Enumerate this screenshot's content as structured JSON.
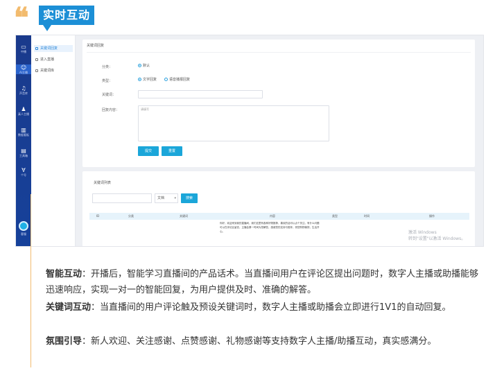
{
  "header": {
    "quote_mark": "❝",
    "title": "实时互动"
  },
  "app": {
    "sidebar": [
      {
        "label": "中播",
        "icon": "broadcast-icon",
        "glyph": "▭"
      },
      {
        "label": "AI主播",
        "icon": "robot-icon",
        "glyph": "☺"
      },
      {
        "label": "声音库",
        "icon": "voice-icon",
        "glyph": "♫"
      },
      {
        "label": "真人主播",
        "icon": "person-icon",
        "glyph": "♟"
      },
      {
        "label": "数据看板",
        "icon": "chart-icon",
        "glyph": "▥"
      },
      {
        "label": "工具箱",
        "icon": "toolbox-icon",
        "glyph": "▤"
      },
      {
        "label": "个号",
        "icon": "account-icon",
        "glyph": "∀"
      }
    ],
    "sidebar_bottom_label": "客服",
    "submenu": [
      "关键词回复",
      "进入直播",
      "关键词库"
    ],
    "form": {
      "title": "关键词回复",
      "labels": {
        "category": "分类：",
        "type": "类型：",
        "keyword": "关键词：",
        "reply": "回复内容："
      },
      "category_option": "默认",
      "type_options": [
        "文字回复",
        "语音播报回复"
      ],
      "reply_placeholder": "请填写",
      "submit": "提交",
      "reset": "重置"
    },
    "list": {
      "title": "关键词列表",
      "select_value": "文档",
      "search_button": "搜索",
      "columns": [
        "ID",
        "分类",
        "关键词",
        "内容",
        "类型",
        "时间",
        "操作"
      ],
      "sample_cell": "你好，欢迎来到我的直播间，我们这里有各种好物推荐，喜欢的话可以点个关注，有什么问题可以在评论区留言，主播会第一时间为您解答，感谢您的支持与陪伴，祝您购物愉快，生活开心。"
    },
    "watermark": [
      "激活 Windows",
      "转到\"设置\"以激活 Windows。"
    ]
  },
  "paragraphs": [
    {
      "term": "智能互动",
      "text": "：开播后，智能学习直播间的产品话术。当直播间用户在评论区提出问题时，数字人主播或助播能够迅速响应，实现一对一的智能回复，为用户提供及时、准确的解答。"
    },
    {
      "term": "关键词互动",
      "text": "：当直播间的用户评论触及预设关键词时，数字人主播或助播会立即进行1V1的自动回复。"
    },
    {
      "term": "氛围引导",
      "text": "：新人欢迎、关注感谢、点赞感谢、礼物感谢等支持数字人主播/助播互动，真实感满分。"
    }
  ]
}
